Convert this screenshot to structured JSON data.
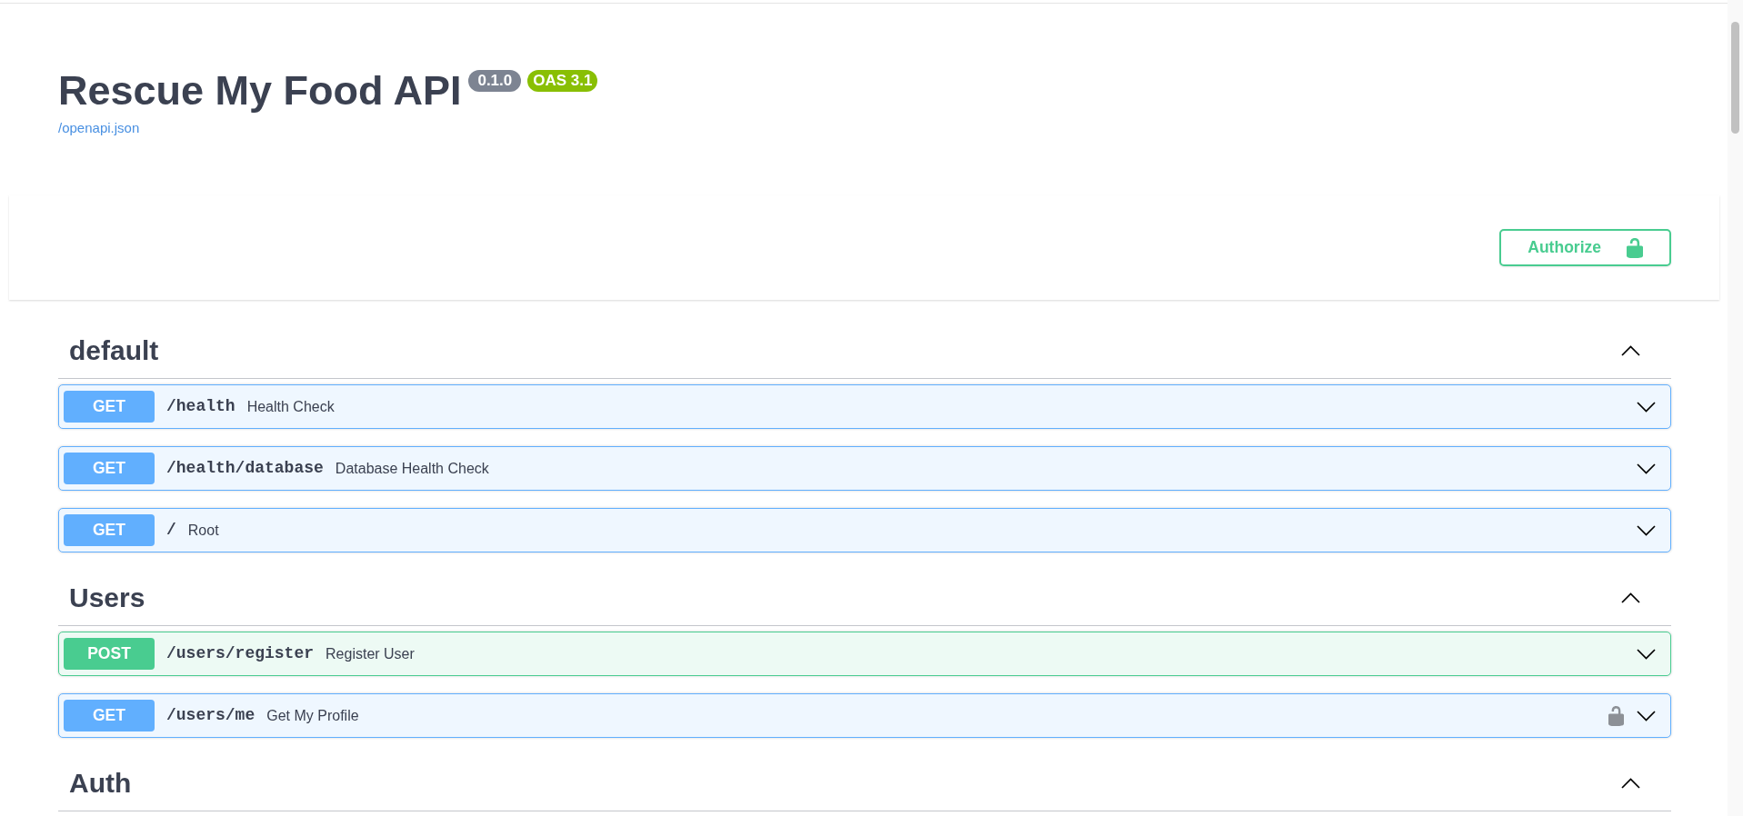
{
  "info": {
    "title": "Rescue My Food API",
    "badges": [
      {
        "kind": "version",
        "text": "0.1.0"
      },
      {
        "kind": "oas",
        "text": "OAS 3.1"
      }
    ],
    "spec_link": "/openapi.json"
  },
  "authorize": {
    "label": "Authorize",
    "authorized": false
  },
  "sections": [
    {
      "name": "default",
      "expanded": true,
      "operations": [
        {
          "kind": "get",
          "method": "GET",
          "path": "/health",
          "summary": "Health Check",
          "secured": false,
          "expanded": false
        },
        {
          "kind": "get",
          "method": "GET",
          "path": "/health/database",
          "summary": "Database Health Check",
          "secured": false,
          "expanded": false
        },
        {
          "kind": "get",
          "method": "GET",
          "path": "/",
          "summary": "Root",
          "secured": false,
          "expanded": false
        }
      ]
    },
    {
      "name": "Users",
      "expanded": true,
      "operations": [
        {
          "kind": "post",
          "method": "POST",
          "path": "/users/register",
          "summary": "Register User",
          "secured": false,
          "expanded": false
        },
        {
          "kind": "get",
          "method": "GET",
          "path": "/users/me",
          "summary": "Get My Profile",
          "secured": true,
          "expanded": false
        }
      ]
    },
    {
      "name": "Auth",
      "expanded": true
    }
  ]
}
